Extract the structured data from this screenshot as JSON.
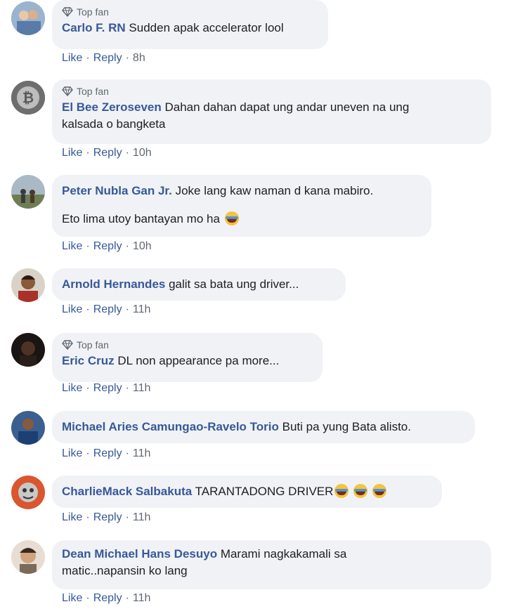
{
  "comments": [
    {
      "badge": "Top fan",
      "name": "Carlo F. RN",
      "text": "Sudden apak accelerator lool",
      "like": "Like",
      "reply": "Reply",
      "time": "8h",
      "avatar_color": "#8aa4c4"
    },
    {
      "badge": "Top fan",
      "name": "El Bee Zeroseven",
      "text": "Dahan dahan dapat ung andar uneven na ung",
      "text2": "kalsada o bangketa",
      "like": "Like",
      "reply": "Reply",
      "time": "10h",
      "avatar_color": "#555555"
    },
    {
      "name": "Peter Nubla Gan Jr.",
      "text": "Joke lang kaw naman d kana mabiro.",
      "text2": "Eto lima utoy bantayan mo ha",
      "like": "Like",
      "reply": "Reply",
      "time": "10h",
      "avatar_color": "#7d8a6a"
    },
    {
      "name": "Arnold Hernandes",
      "text": "galit sa bata ung driver...",
      "like": "Like",
      "reply": "Reply",
      "time": "11h",
      "avatar_color": "#7a3b2e"
    },
    {
      "badge": "Top fan",
      "name": "Eric Cruz",
      "text": "DL non appearance pa more...",
      "like": "Like",
      "reply": "Reply",
      "time": "11h",
      "avatar_color": "#2a2220"
    },
    {
      "name": "Michael Aries Camungao-Ravelo Torio",
      "text": "Buti pa yung Bata alisto.",
      "like": "Like",
      "reply": "Reply",
      "time": "11h",
      "avatar_color": "#2d4f8a"
    },
    {
      "name": "CharlieMack Salbakuta",
      "text": "TARANTADONG DRIVER",
      "like": "Like",
      "reply": "Reply",
      "time": "11h",
      "avatar_color": "#c0503a"
    },
    {
      "name": "Dean Michael Hans Desuyo",
      "text": "Marami nagkakamali sa",
      "text2": "matic..napansin ko lang",
      "like": "Like",
      "reply": "Reply",
      "time": "11h",
      "avatar_color": "#b08a70"
    }
  ]
}
